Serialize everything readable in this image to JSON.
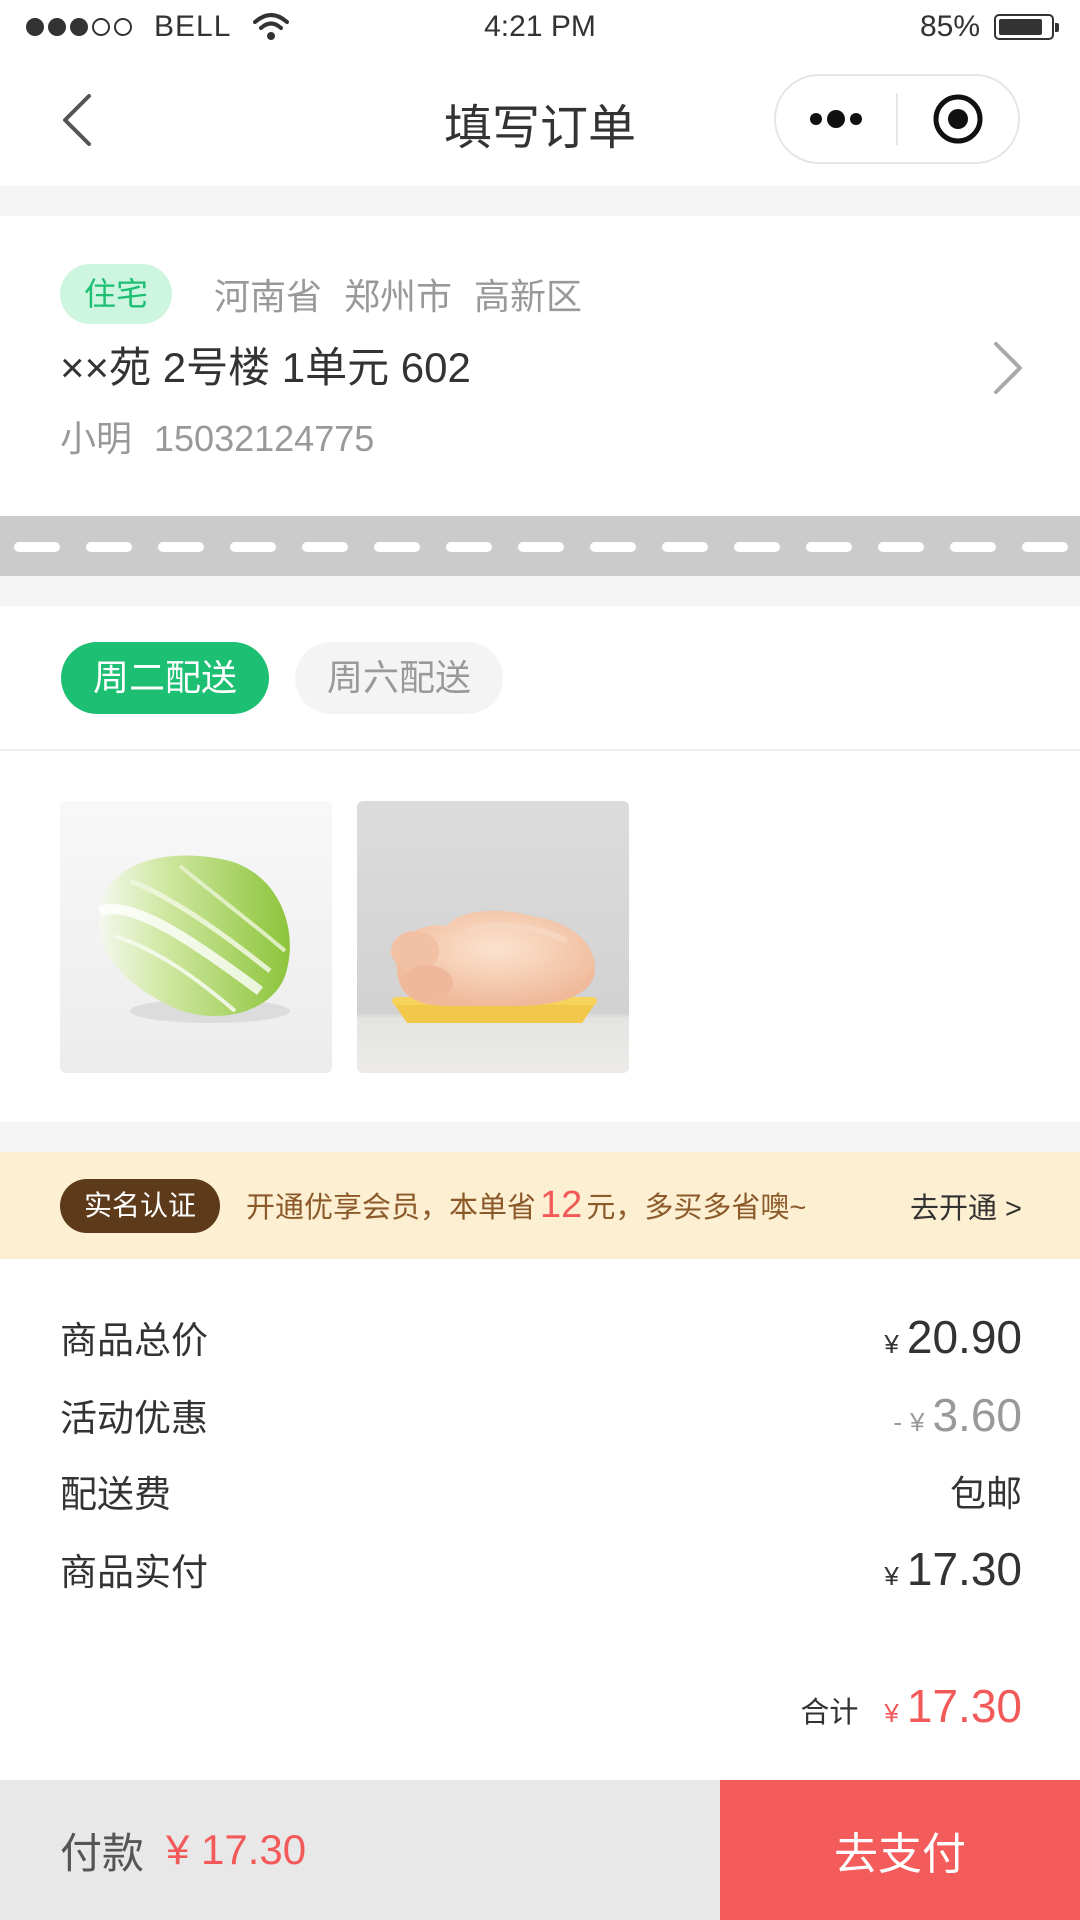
{
  "status_bar": {
    "carrier": "BELL",
    "time": "4:21 PM",
    "battery": "85%",
    "battery_level": 0.85
  },
  "nav": {
    "title": "填写订单"
  },
  "address": {
    "tag": "住宅",
    "province": "河南省",
    "city": "郑州市",
    "district": "高新区",
    "detail": "××苑 2号楼 1单元 602",
    "name": "小明",
    "phone": "15032124775"
  },
  "delivery": {
    "tabs": [
      {
        "label": "周二配送",
        "active": true
      },
      {
        "label": "周六配送",
        "active": false
      }
    ]
  },
  "products": [
    {
      "icon": "napa-cabbage"
    },
    {
      "icon": "raw-chicken"
    }
  ],
  "member_banner": {
    "tag": "实名认证",
    "text_before": "开通优享会员，本单省",
    "amount": "12",
    "text_after": "元，多买多省噢~",
    "link": "去开通 >"
  },
  "summary": {
    "currency": "¥",
    "rows": [
      {
        "label": "商品总价",
        "prefix": "",
        "value": "20.90"
      },
      {
        "label": "活动优惠",
        "prefix": "-",
        "value": "3.60"
      },
      {
        "label": "配送费",
        "value": "包邮"
      },
      {
        "label": "商品实付",
        "prefix": "",
        "value": "17.30"
      }
    ],
    "total_label": "合计",
    "total_value": "17.30"
  },
  "bottom_bar": {
    "pay_label": "付款",
    "pay_amount": "¥ 17.30",
    "pay_button": "去支付"
  },
  "colors": {
    "accent_green": "#1dbf73",
    "accent_red": "#f45c5c",
    "banner_bg": "#fdefd1"
  }
}
